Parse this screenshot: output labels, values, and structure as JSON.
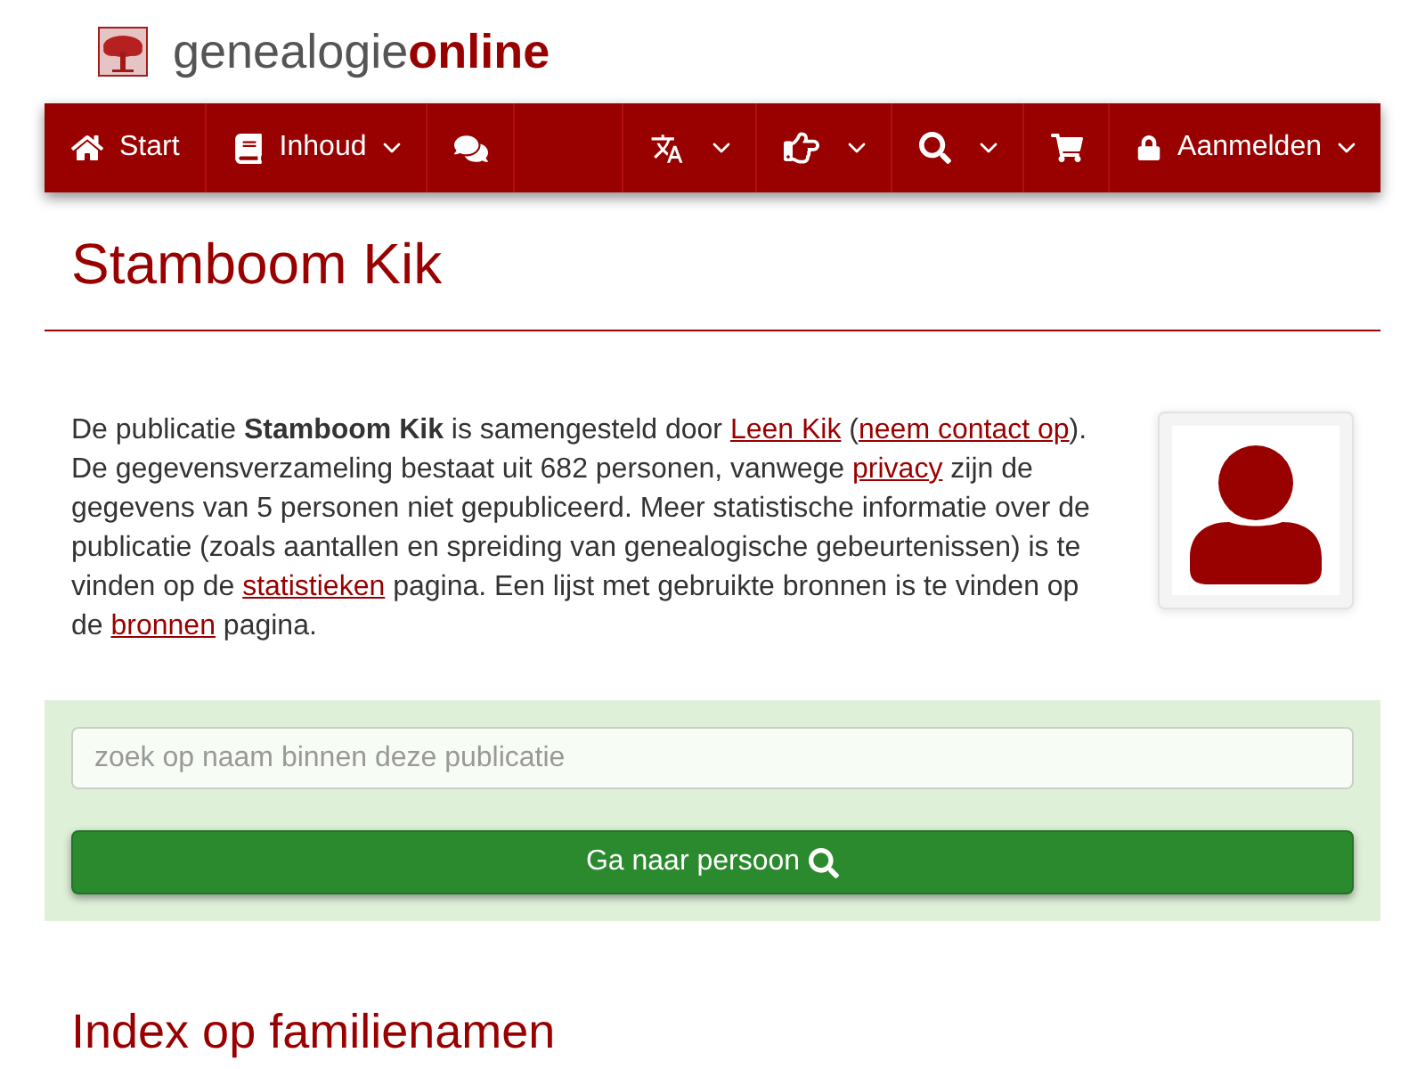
{
  "brand": {
    "name": "genealogie**online**"
  },
  "nav": {
    "left": [
      {
        "label": "Start",
        "dropdown": false
      },
      {
        "label": "Inhoud",
        "dropdown": true
      },
      {
        "dropdown": false
      }
    ],
    "right": [
      {
        "dropdown": true
      },
      {
        "dropdown": true
      },
      {
        "dropdown": true
      },
      {
        "dropdown": false
      },
      {
        "label": "Aanmelden",
        "dropdown": true
      }
    ]
  },
  "page": {
    "title": "Stamboom Kik"
  },
  "intro": {
    "segments": [
      {
        "kind": "text",
        "text": "De publicatie **Stamboom Kik** is samengesteld door "
      },
      {
        "kind": "link",
        "text": "Leen Kik"
      },
      {
        "kind": "text",
        "text": " ("
      },
      {
        "kind": "link",
        "text": "neem contact op"
      },
      {
        "kind": "text",
        "text": "). De gegevensverzameling bestaat uit 682 personen, vanwege "
      },
      {
        "kind": "link",
        "text": "privacy"
      },
      {
        "kind": "text",
        "text": " zijn de gegevens van 5 personen niet gepubliceerd. Meer statistische informatie over de publicatie (zoals aantallen en spreiding van genealogische gebeurtenissen) is te vinden op de "
      },
      {
        "kind": "link",
        "text": "statistieken"
      },
      {
        "kind": "text",
        "text": " pagina. Een lijst met gebruikte bronnen is te vinden op de "
      },
      {
        "kind": "link",
        "text": "bronnen"
      },
      {
        "kind": "text",
        "text": " pagina."
      }
    ]
  },
  "search": {
    "placeholder": "zoek op naam binnen deze publicatie",
    "button": "Ga naar persoon"
  },
  "section": {
    "title": "Index op familienamen"
  }
}
